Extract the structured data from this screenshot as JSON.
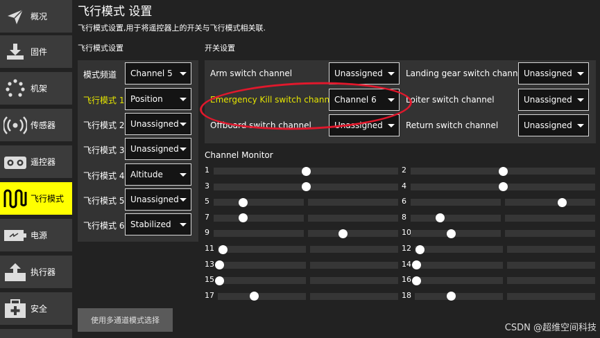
{
  "sidebar": {
    "items": [
      {
        "label": "概况",
        "icon": "paper-plane-icon"
      },
      {
        "label": "固件",
        "icon": "download-icon"
      },
      {
        "label": "机架",
        "icon": "airframe-dots-icon"
      },
      {
        "label": "传感器",
        "icon": "radio-waves-icon"
      },
      {
        "label": "遥控器",
        "icon": "remote-control-icon"
      },
      {
        "label": "飞行模式",
        "icon": "wave-icon",
        "active": true
      },
      {
        "label": "电源",
        "icon": "battery-icon"
      },
      {
        "label": "执行器",
        "icon": "actuator-icon"
      },
      {
        "label": "安全",
        "icon": "medkit-icon"
      }
    ]
  },
  "header": {
    "title": "飞行模式 设置",
    "description": "飞行模式设置,用于将遥控器上的开关与飞行模式相关联."
  },
  "flight_modes": {
    "section_title": "飞行模式设置",
    "channel_label": "模式频道",
    "channel_value": "Channel 5",
    "modes": [
      {
        "label": "飞行模式 1",
        "value": "Position",
        "highlighted": true
      },
      {
        "label": "飞行模式 2",
        "value": "Unassigned"
      },
      {
        "label": "飞行模式 3",
        "value": "Unassigned"
      },
      {
        "label": "飞行模式 4",
        "value": "Altitude"
      },
      {
        "label": "飞行模式 5",
        "value": "Unassigned"
      },
      {
        "label": "飞行模式 6",
        "value": "Stabilized"
      }
    ]
  },
  "switches": {
    "section_title": "开关设置",
    "items": [
      {
        "label": "Arm switch channel",
        "value": "Unassigned"
      },
      {
        "label": "Emergency Kill switch channel",
        "value": "Channel 6",
        "highlighted": true
      },
      {
        "label": "Offboard switch channel",
        "value": "Unassigned"
      },
      {
        "label": "Landing gear switch channel",
        "value": "Unassigned"
      },
      {
        "label": "Loiter switch channel",
        "value": "Unassigned"
      },
      {
        "label": "Return switch channel",
        "value": "Unassigned"
      }
    ]
  },
  "channel_monitor": {
    "title": "Channel Monitor",
    "channels": [
      {
        "n": "1",
        "level": 0.5
      },
      {
        "n": "2",
        "level": 0.5
      },
      {
        "n": "3",
        "level": 0.5
      },
      {
        "n": "4",
        "level": 0.5
      },
      {
        "n": "5",
        "level": 0.16
      },
      {
        "n": "6",
        "level": 0.82
      },
      {
        "n": "7",
        "level": 0.16
      },
      {
        "n": "8",
        "level": 0.16
      },
      {
        "n": "9",
        "level": 0.7
      },
      {
        "n": "10",
        "level": 0.22
      },
      {
        "n": "11",
        "level": 0.03
      },
      {
        "n": "12",
        "level": 0.03
      },
      {
        "n": "13",
        "level": 0.01
      },
      {
        "n": "14",
        "level": 0.01
      },
      {
        "n": "15",
        "level": 0.01
      },
      {
        "n": "16",
        "level": 0.01
      },
      {
        "n": "17",
        "level": 0.2
      },
      {
        "n": "18",
        "level": 0.2
      }
    ]
  },
  "footer": {
    "multi_channel_button": "使用多通道模式选择"
  },
  "watermark": "CSDN @超维空间科技",
  "colors": {
    "accent": "#ffff00",
    "highlight_text": "#e6e600",
    "annotation": "#e0182c"
  }
}
